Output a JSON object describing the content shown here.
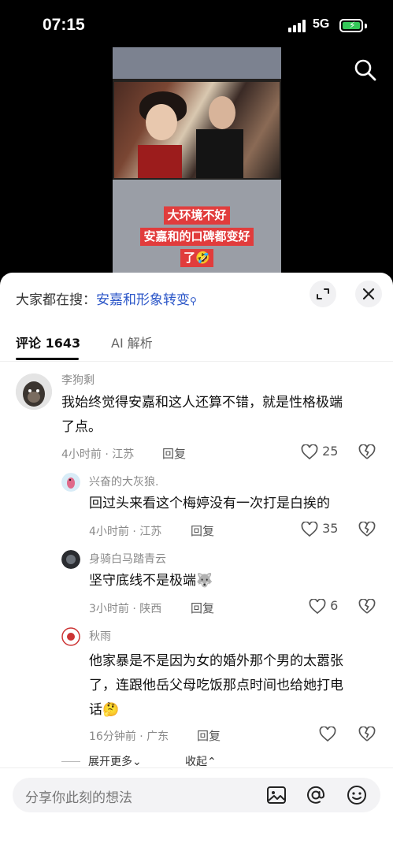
{
  "status_bar": {
    "time": "07:15",
    "network": "5G"
  },
  "video": {
    "caption_lines": [
      "大环境不好",
      "安嘉和的口碑都变好",
      "了🤣"
    ]
  },
  "sheet": {
    "search_prefix": "大家都在搜：",
    "search_keyword": "安嘉和形象转变",
    "tabs": [
      {
        "label": "评论 1643"
      },
      {
        "label": "AI 解析"
      }
    ]
  },
  "comments": [
    {
      "user": "李狗剩",
      "text_lines": [
        "我始终觉得安嘉和这人还算不错，就是性格极端",
        "了点。"
      ],
      "meta": "4小时前 · 江苏",
      "reply": "回复",
      "likes": "25"
    },
    {
      "user": "兴奋的大灰狼.",
      "text_lines": [
        "回过头来看这个梅婷没有一次打是白挨的"
      ],
      "meta": "4小时前 · 江苏",
      "reply": "回复",
      "likes": "35"
    },
    {
      "user": "身骑白马踏青云",
      "text_lines": [
        "坚守底线不是极端🐺"
      ],
      "meta": "3小时前 · 陕西",
      "reply": "回复",
      "likes": "6"
    },
    {
      "user": "秋雨",
      "text_lines": [
        "他家暴是不是因为女的婚外那个男的太嚣张",
        "了，连跟他岳父母吃饭那点时间也给她打电",
        "话🤔"
      ],
      "meta": "16分钟前 · 广东",
      "reply": "回复",
      "likes": ""
    }
  ],
  "thread_controls": {
    "expand_more": "展开更多⌄",
    "collapse": "收起⌃"
  },
  "input": {
    "placeholder": "分享你此刻的想法"
  },
  "colors": {
    "accent_blue": "#2b56c8",
    "caption_red": "#e13c3c",
    "battery_green": "#34c759"
  }
}
